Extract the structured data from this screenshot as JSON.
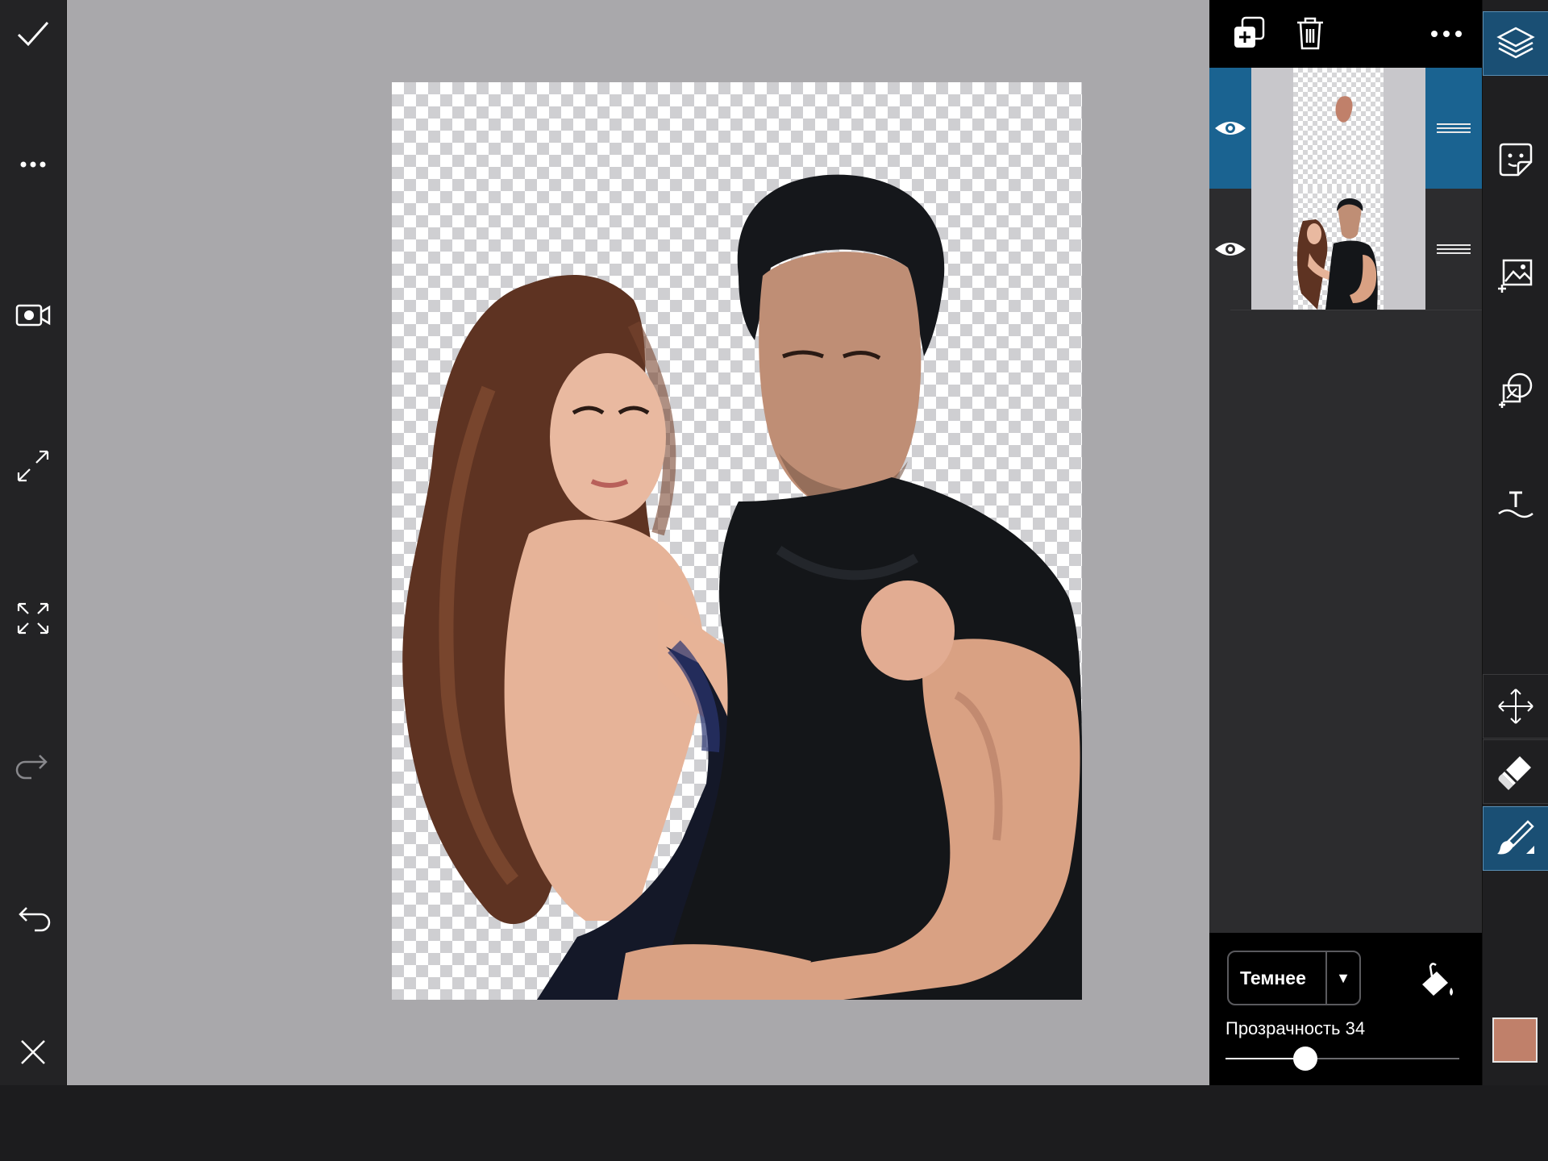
{
  "left_toolbar": {
    "items": [
      {
        "icon": "checkmark-icon"
      },
      {
        "icon": "more-icon"
      },
      {
        "icon": "video-record-icon"
      },
      {
        "icon": "resize-icon"
      },
      {
        "icon": "fullscreen-icon"
      },
      {
        "icon": "redo-icon"
      },
      {
        "icon": "undo-icon"
      },
      {
        "icon": "close-icon"
      }
    ]
  },
  "layers_panel": {
    "header_actions": [
      {
        "icon": "add-layer-icon"
      },
      {
        "icon": "trash-icon"
      },
      {
        "icon": "more-icon"
      }
    ],
    "layers": [
      {
        "selected": true,
        "visible": true,
        "content": "brush stroke"
      },
      {
        "selected": false,
        "visible": true,
        "content": "photo"
      }
    ],
    "blend_mode": "Темнее",
    "opacity_label": "Прозрачность 34",
    "opacity_value": 34,
    "fill_icon": "paint-bucket-icon"
  },
  "right_toolbar": {
    "items": [
      {
        "icon": "layers-icon",
        "active": true
      },
      {
        "icon": "sticker-icon"
      },
      {
        "icon": "add-image-icon"
      },
      {
        "icon": "shapes-icon"
      },
      {
        "icon": "text-icon"
      },
      {
        "icon": "move-icon"
      },
      {
        "icon": "eraser-icon"
      },
      {
        "icon": "brush-icon",
        "active": true
      }
    ],
    "brush_color": "#c0806a"
  },
  "colors": {
    "accent": "#1a6391",
    "canvas_bg": "#a9a8ab"
  }
}
